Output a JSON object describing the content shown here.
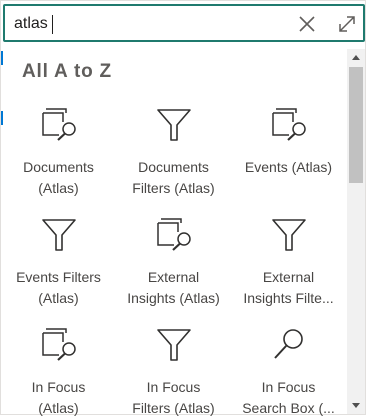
{
  "search": {
    "value": "atlas"
  },
  "section": {
    "heading": "All A to Z"
  },
  "items": [
    {
      "line1": "Documents",
      "line2": "(Atlas)",
      "icon": "documents-search-icon"
    },
    {
      "line1": "Documents",
      "line2": "Filters (Atlas)",
      "icon": "filter-funnel-icon"
    },
    {
      "line1": "Events (Atlas)",
      "line2": "",
      "icon": "documents-search-icon"
    },
    {
      "line1": "Events Filters",
      "line2": "(Atlas)",
      "icon": "filter-funnel-icon"
    },
    {
      "line1": "External",
      "line2": "Insights (Atlas)",
      "icon": "documents-search-icon"
    },
    {
      "line1": "External",
      "line2": "Insights Filte...",
      "icon": "filter-funnel-icon"
    },
    {
      "line1": "In Focus",
      "line2": "(Atlas)",
      "icon": "documents-search-icon"
    },
    {
      "line1": "In Focus",
      "line2": "Filters (Atlas)",
      "icon": "filter-funnel-icon"
    },
    {
      "line1": "In Focus",
      "line2": "Search Box (...",
      "icon": "search-magnifier-icon"
    }
  ],
  "colors": {
    "accent": "#1f7a6e",
    "icon": "#323130",
    "text": "#484644",
    "heading": "#605e5c"
  }
}
